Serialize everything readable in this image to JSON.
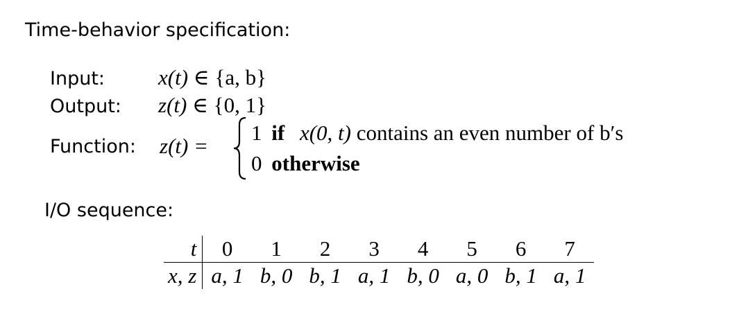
{
  "heading": "Time-behavior specification:",
  "input": {
    "label": "Input:",
    "lhs": "x(t)",
    "rel": "∈",
    "set": "{a, b}"
  },
  "output": {
    "label": "Output:",
    "lhs": "z(t)",
    "rel": "∈",
    "set": "{0, 1}"
  },
  "function": {
    "label": "Function:",
    "lhs": "z(t) =",
    "case1_value": "1",
    "case1_keyword": "if",
    "case1_condition_var": "x(0, t)",
    "case1_condition_text": "contains an even number of",
    "case1_condition_end": "b′s",
    "case2_value": "0",
    "case2_keyword": "otherwise"
  },
  "io_heading": "I/O sequence:",
  "io_table": {
    "row1_header": "t",
    "row2_header": "x, z",
    "times": [
      "0",
      "1",
      "2",
      "3",
      "4",
      "5",
      "6",
      "7"
    ],
    "pairs": [
      "a, 1",
      "b, 0",
      "b, 1",
      "a, 1",
      "b, 0",
      "a, 0",
      "b, 1",
      "a, 1"
    ]
  }
}
